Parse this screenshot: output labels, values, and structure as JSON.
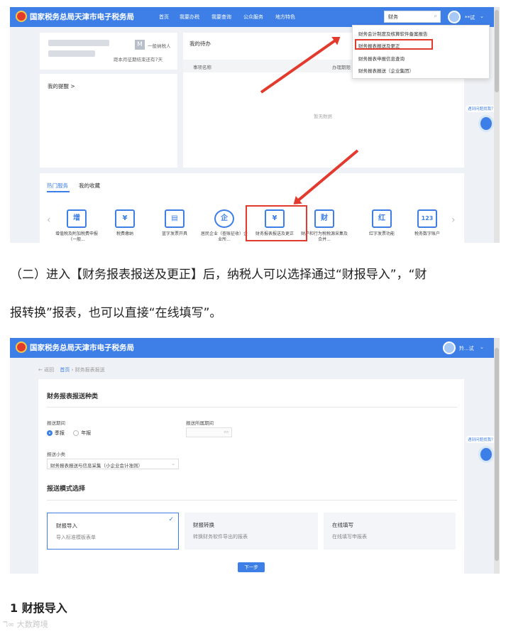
{
  "shot1": {
    "site_title": "国家税务总局天津市电子税务局",
    "nav": [
      "首页",
      "我要办税",
      "我要查询",
      "公众服务",
      "地方特色"
    ],
    "search_value": "财务",
    "user_name": "**试",
    "left_card": {
      "badge": "一般纳税人",
      "deadline": "距本月征期结束还有7天",
      "reminder_title": "我的提醒 >"
    },
    "todo": {
      "title": "我的待办",
      "col_name": "事项名称",
      "col_deadline": "办理期限",
      "empty": "暂无数据"
    },
    "dropdown": [
      "财务会计制度及核算软件备案报告",
      "财务报表报送及更正",
      "财务报表申报信息查询",
      "财务报表报送（企业集团）"
    ],
    "tabs": [
      "热门服务",
      "我的收藏"
    ],
    "services": [
      {
        "icon": "增",
        "label": "增值税及附加税费申报（一般..."
      },
      {
        "icon": "¥",
        "label": "税费缴纳"
      },
      {
        "icon": "▤",
        "label": "蓝字发票开具"
      },
      {
        "icon": "企",
        "label": "居民企业（查账征收）企业所..."
      },
      {
        "icon": "¥",
        "label": "财务报表报送及更正"
      },
      {
        "icon": "财",
        "label": "财产和行为税税源采集及合并..."
      },
      {
        "icon": "红",
        "label": "红字发票功能"
      },
      {
        "icon": "123",
        "label": "税务数字账户"
      }
    ],
    "help": "遇到问题找我？"
  },
  "paragraph": {
    "line1": "（二）进入【财务报表报送及更正】后，纳税人可以选择通过“财报导入”，“财",
    "line2": "报转换”报表，也可以直接“在线填写”。"
  },
  "shot2": {
    "site_title": "国家税务总局天津市电子税务局",
    "user_name": "羚...试",
    "back": "返回",
    "breadcrumb": [
      "首页",
      "财务报表报送"
    ],
    "section1": "财务报表报送种类",
    "period_label": "报送期间",
    "period_options": [
      "季报",
      "年报"
    ],
    "belong_label": "报送所属期间",
    "sub_label": "报送小类",
    "sub_value": "财务报表报送与信息采集（小企业会计准则）",
    "section2": "报送模式选择",
    "modes": [
      {
        "title": "财报导入",
        "desc": "导入标准模板表单",
        "selected": true
      },
      {
        "title": "财报转换",
        "desc": "转换财务软件导出的报表",
        "selected": false
      },
      {
        "title": "在线填写",
        "desc": "在线填写申报表",
        "selected": false
      }
    ],
    "next": "下一步",
    "help": "遇到问题找我？"
  },
  "heading": "1 财报导入",
  "watermark": "大数跨境",
  "colors": {
    "primary": "#3d7fe6",
    "highlight_red": "#e23b2e"
  }
}
